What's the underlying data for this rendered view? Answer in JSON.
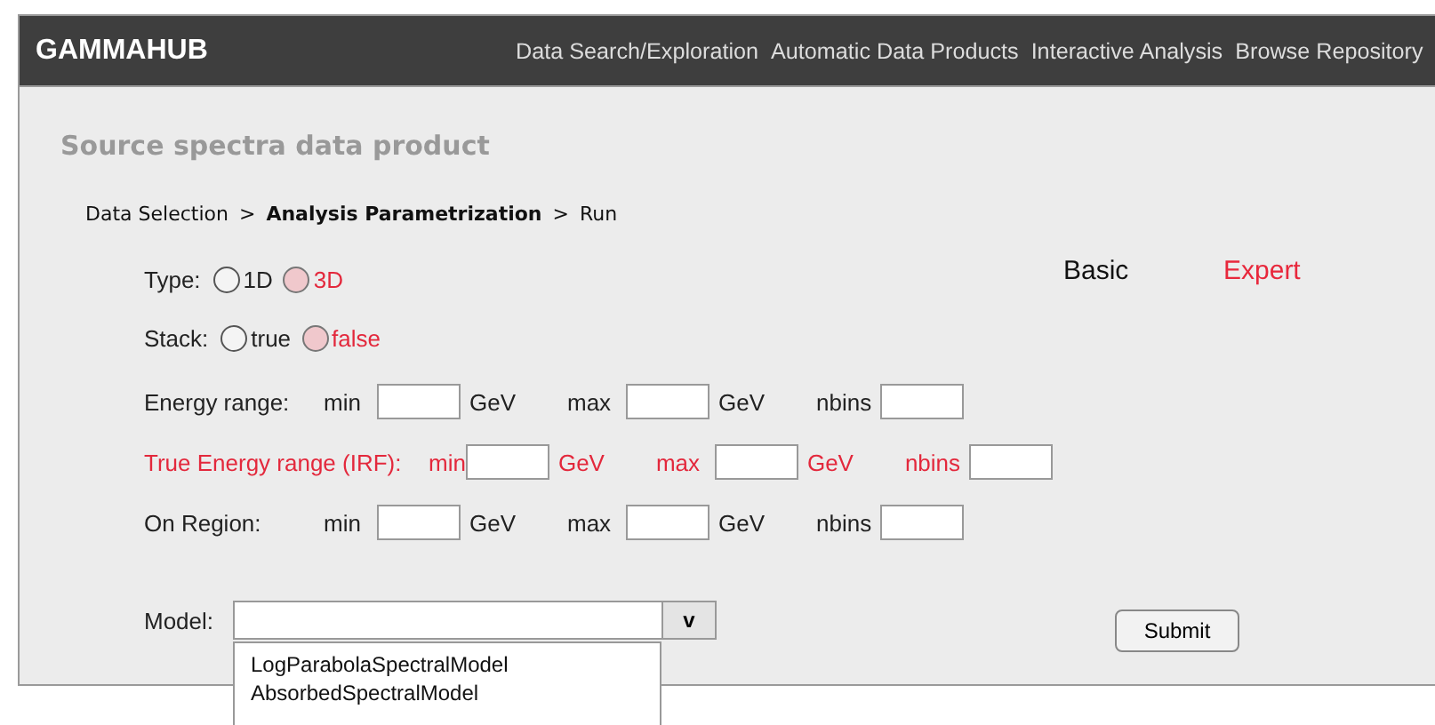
{
  "header": {
    "brand": "GAMMAHUB",
    "nav": [
      {
        "label": "Data Search/Exploration"
      },
      {
        "label": "Automatic Data Products"
      },
      {
        "label": "Interactive Analysis"
      },
      {
        "label": "Browse Repository"
      }
    ]
  },
  "page_title": "Source spectra data product",
  "breadcrumb": [
    {
      "label": "Data Selection",
      "current": false
    },
    {
      "label": "Analysis Parametrization",
      "current": true
    },
    {
      "label": "Run",
      "current": false
    }
  ],
  "breadcrumb_separator": ">",
  "modes": [
    {
      "label": "Basic",
      "selected": false
    },
    {
      "label": "Expert",
      "selected": true
    }
  ],
  "radio_groups": [
    {
      "label": "Type:",
      "options": [
        {
          "label": "1D",
          "selected": false
        },
        {
          "label": "3D",
          "selected": true
        }
      ]
    },
    {
      "label": "Stack:",
      "options": [
        {
          "label": "true",
          "selected": false
        },
        {
          "label": "false",
          "selected": true
        }
      ]
    }
  ],
  "ranges": [
    {
      "label": "Energy range:",
      "highlighted": false,
      "min_label": "min",
      "min_unit": "GeV",
      "max_label": "max",
      "max_unit": "GeV",
      "nbins_label": "nbins"
    },
    {
      "label": "True Energy range (IRF):",
      "highlighted": true,
      "min_label": "min",
      "min_unit": "GeV",
      "max_label": "max",
      "max_unit": "GeV",
      "nbins_label": "nbins"
    },
    {
      "label": "On Region:",
      "highlighted": false,
      "min_label": "min",
      "min_unit": "GeV",
      "max_label": "max",
      "max_unit": "GeV",
      "nbins_label": "nbins"
    }
  ],
  "model": {
    "label": "Model:",
    "toggle": "v",
    "expanded": true,
    "options": [
      "LogParabolaSpectralModel",
      "AbsorbedSpectralModel"
    ]
  },
  "submit": "Submit"
}
